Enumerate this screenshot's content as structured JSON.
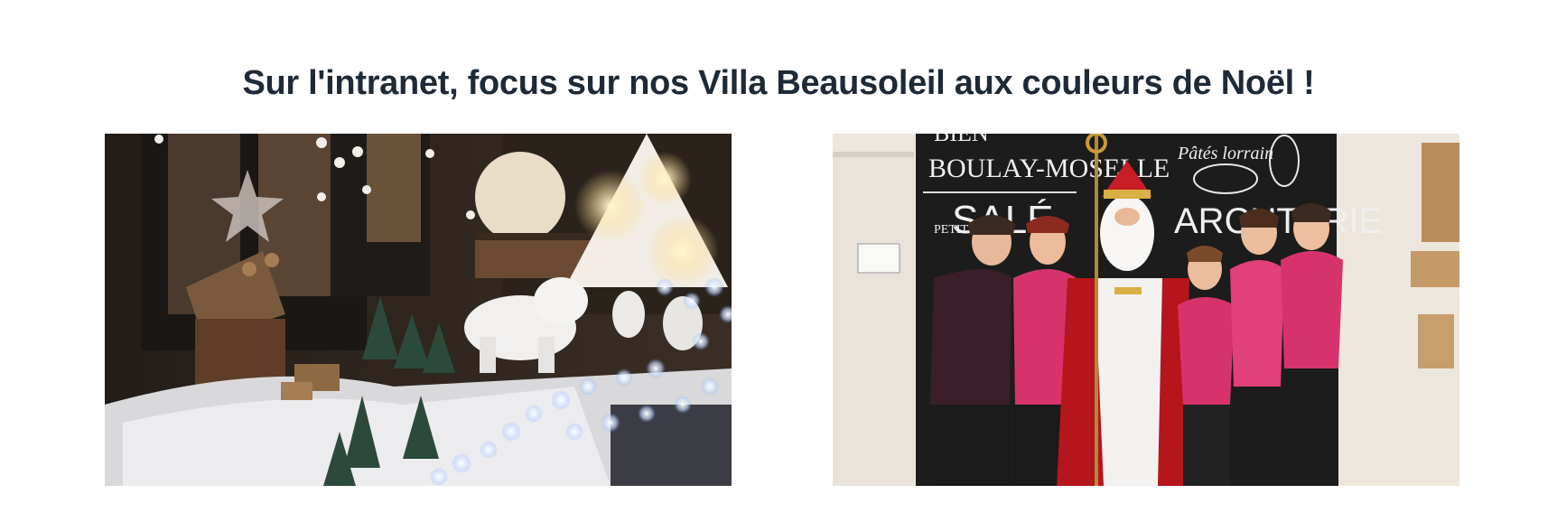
{
  "headline": "Sur l'intranet, focus sur nos Villa Beausoleil aux couleurs de Noël !",
  "photos": [
    {
      "subject": "christmas-window-display",
      "mood": "dark-evening"
    },
    {
      "subject": "staff-with-saint-nicolas",
      "mood": "bright-indoor"
    }
  ],
  "sign_text": {
    "line_top": "BIEN",
    "town": "BOULAY-MOSELLE",
    "pates": "Pâtés lorrain",
    "petit": "PETIT",
    "sale": "SALÉ",
    "charcuterie": "ARCUTERIE"
  },
  "colors": {
    "headline": "#1f2a37",
    "staff_shirt": "#d6336c",
    "bishop_robe": "#b4161b",
    "chalkboard": "#1c1c1c"
  }
}
